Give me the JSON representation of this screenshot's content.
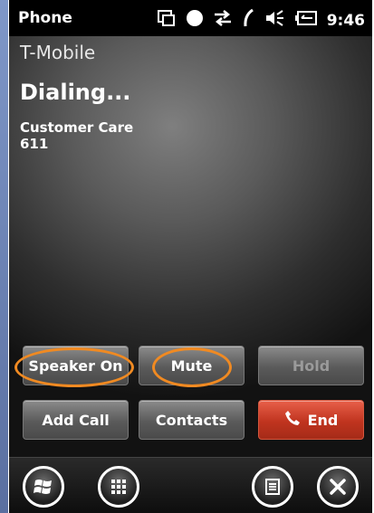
{
  "status_bar": {
    "app_title": "Phone",
    "time": "9:46",
    "icons": [
      "sync-icon",
      "presence-dot-icon",
      "data-arrows-icon",
      "call-icon",
      "volume-icon",
      "battery-icon"
    ]
  },
  "call": {
    "carrier": "T-Mobile",
    "state": "Dialing...",
    "contact_name": "Customer Care",
    "number": "611"
  },
  "buttons": {
    "speaker": "Speaker On",
    "mute": "Mute",
    "hold": "Hold",
    "add_call": "Add Call",
    "contacts": "Contacts",
    "end": "End"
  },
  "taskbar": {
    "icons": [
      "windows-start-icon",
      "apps-grid-icon",
      "menu-icon",
      "close-icon"
    ]
  },
  "colors": {
    "end_red": "#c0341f",
    "highlight_orange": "#f08a22",
    "edge_blue": "#6f86b8"
  }
}
